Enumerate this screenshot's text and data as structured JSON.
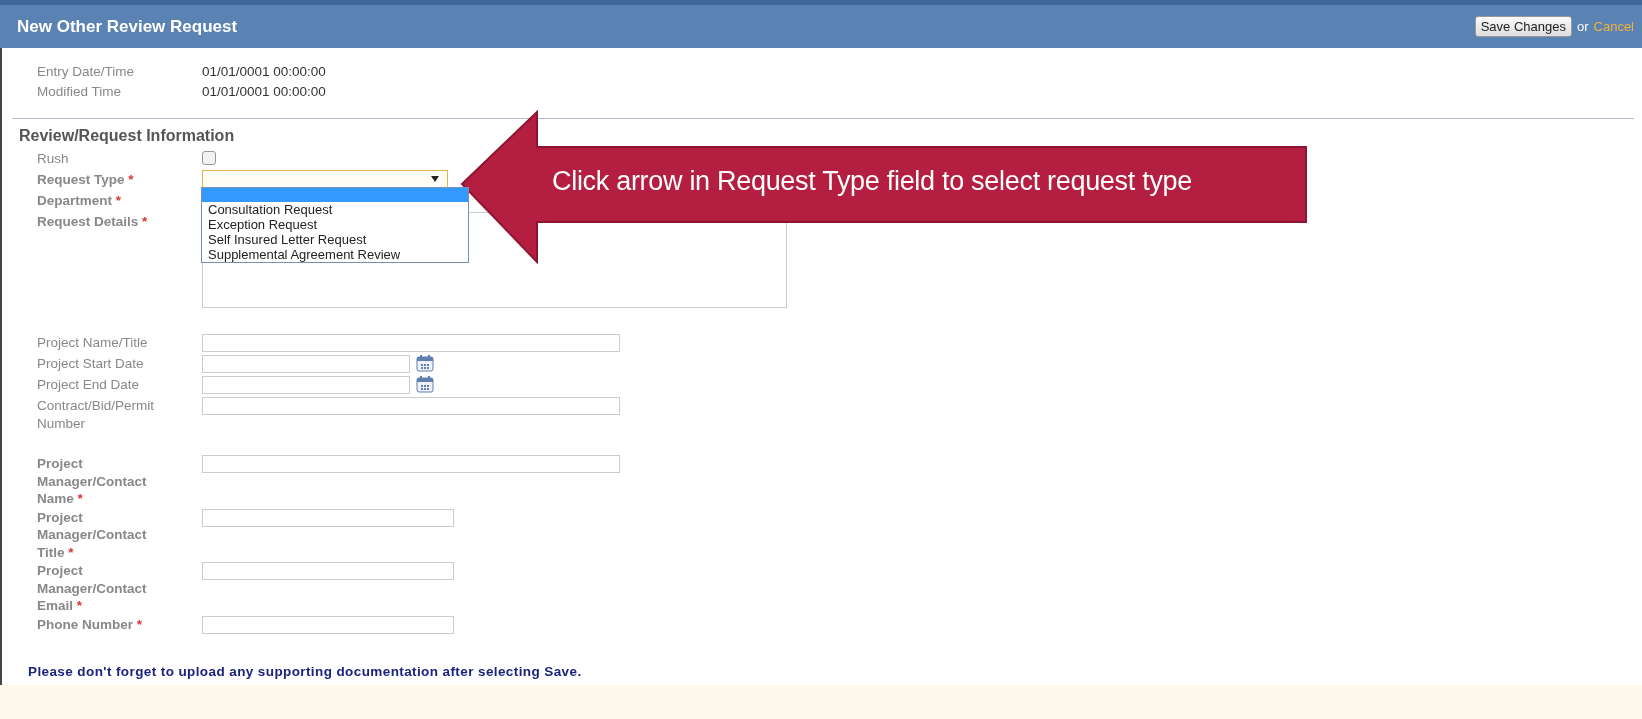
{
  "header": {
    "title": "New Other Review Request",
    "save_button": "Save Changes",
    "or_text": "or",
    "cancel_link": "Cancel"
  },
  "meta": [
    {
      "label": "Entry Date/Time",
      "value": "01/01/0001 00:00:00"
    },
    {
      "label": "Modified Time",
      "value": "01/01/0001 00:00:00"
    }
  ],
  "section_title": "Review/Request Information",
  "fields": [
    {
      "kind": "checkbox",
      "label": "Rush",
      "required": false,
      "checked": false
    },
    {
      "kind": "select",
      "label": "Request Type",
      "required": true,
      "required_mark": "*",
      "focused": true,
      "dropdown": {
        "blank_option_highlighted": true,
        "options": [
          {
            "label": "Consultation Request",
            "selected": false
          },
          {
            "label": "Exception Request",
            "selected": false
          },
          {
            "label": "Self Insured Letter Request",
            "selected": false
          },
          {
            "label": "Supplemental Agreement Review",
            "selected": false
          }
        ]
      }
    },
    {
      "kind": "covered",
      "label": "Department",
      "required": true,
      "required_mark": "*"
    },
    {
      "kind": "textarea",
      "label": "Request Details",
      "required": true,
      "required_mark": "*"
    },
    {
      "kind": "text_long",
      "label": "Project Name/Title",
      "required": false
    },
    {
      "kind": "date",
      "label": "Project Start Date",
      "required": false
    },
    {
      "kind": "date",
      "label": "Project End Date",
      "required": false
    },
    {
      "kind": "text_long",
      "label": "Contract/Bid/Permit Number",
      "required": false
    },
    {
      "kind": "text_long",
      "label": "Project Manager/Contact Name",
      "required": true,
      "required_mark": "*"
    },
    {
      "kind": "text_short",
      "label": "Project Manager/Contact Title",
      "required": true,
      "required_mark": "*"
    },
    {
      "kind": "text_short",
      "label": "Project Manager/Contact Email",
      "required": true,
      "required_mark": "*"
    },
    {
      "kind": "text_short",
      "label": "Phone Number",
      "required": true,
      "required_mark": "*"
    }
  ],
  "footer_note": "Please don't forget to upload any supporting documentation after selecting Save.",
  "callout": {
    "text": "Click arrow in Request Type field to select request type"
  }
}
